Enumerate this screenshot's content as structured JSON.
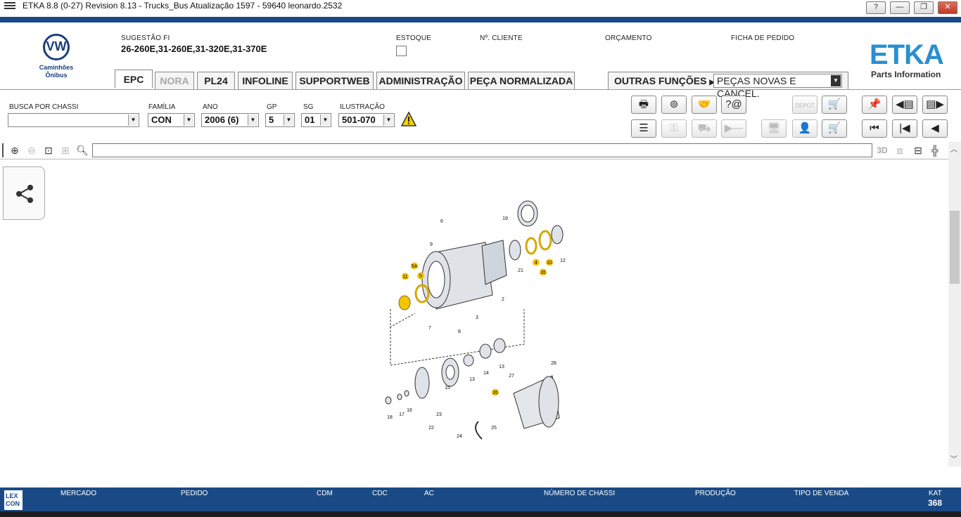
{
  "window": {
    "title": "ETKA 8.8 (0-27) Revision 8.13 - Trucks_Bus Atualização 1597 - 59640 leonardo.2532",
    "controls": [
      "?",
      "—",
      "❐",
      "✕"
    ]
  },
  "header": {
    "brand_lines": [
      "Caminhões",
      "Ônibus"
    ],
    "sugestao_label": "SUGESTÃO FI",
    "sugestao_value": "26-260E,31-260E,31-320E,31-370E",
    "estoque_label": "ESTOQUE",
    "cliente_label": "Nº. CLIENTE",
    "orcamento_label": "ORÇAMENTO",
    "ficha_label": "FICHA DE PEDIDO",
    "etka_logo": "ETKA",
    "etka_sub": "Parts Information"
  },
  "tabs": [
    {
      "label": "EPC",
      "state": "active"
    },
    {
      "label": "NORA",
      "state": "disabled"
    },
    {
      "label": "PL24",
      "state": "normal"
    },
    {
      "label": "INFOLINE",
      "state": "normal"
    },
    {
      "label": "SUPPORTWEB",
      "state": "normal"
    },
    {
      "label": "ADMINISTRAÇÃO",
      "state": "normal"
    },
    {
      "label": "PEÇA NORMALIZADA",
      "state": "normal"
    }
  ],
  "outras": {
    "label": "OUTRAS FUNÇÕES",
    "selected": "PEÇAS NOVAS E CANCEL."
  },
  "filters": {
    "chassi_label": "BUSCA POR CHASSI",
    "chassi_value": "",
    "familia_label": "FAMÍLIA",
    "familia_value": "CON",
    "ano_label": "ANO",
    "ano_value": "2006 (6)",
    "gp_label": "GP",
    "gp_value": "5",
    "sg_label": "SG",
    "sg_value": "01",
    "ilustracao_label": "ILUSTRAÇÃO",
    "ilustracao_value": "501-070"
  },
  "toolbar": {
    "row1": [
      {
        "icon": "printer-icon",
        "glyph": "🖶",
        "enabled": true
      },
      {
        "icon": "scanner-icon",
        "glyph": "⊚",
        "enabled": true
      },
      {
        "icon": "handshake-icon",
        "glyph": "🤝",
        "enabled": true
      },
      {
        "icon": "question-at-icon",
        "glyph": "?@",
        "enabled": true
      },
      {
        "icon": "depot-icon",
        "glyph": "DEPOT",
        "enabled": false
      },
      {
        "icon": "cart-out-icon",
        "glyph": "🛒",
        "enabled": true
      },
      {
        "icon": "pin-icon",
        "glyph": "📌",
        "enabled": true
      },
      {
        "icon": "doc-prev-icon",
        "glyph": "◀▤",
        "enabled": true
      },
      {
        "icon": "doc-next-icon",
        "glyph": "▤▶",
        "enabled": true
      }
    ],
    "row2": [
      {
        "icon": "list-icon",
        "glyph": "☰",
        "enabled": true
      },
      {
        "icon": "key-icon",
        "glyph": "⚿",
        "enabled": false
      },
      {
        "icon": "vehicle-icon",
        "glyph": "⛟",
        "enabled": false
      },
      {
        "icon": "play-minus-icon",
        "glyph": "▶—",
        "enabled": false
      },
      {
        "icon": "monitor-icon",
        "glyph": "🖥",
        "enabled": false
      },
      {
        "icon": "person-icon",
        "glyph": "👤",
        "enabled": false
      },
      {
        "icon": "cart-icon",
        "glyph": "🛒",
        "enabled": true
      },
      {
        "icon": "first-icon",
        "glyph": "⏮",
        "enabled": true
      },
      {
        "icon": "prev-icon",
        "glyph": "|◀",
        "enabled": true
      },
      {
        "icon": "back-icon",
        "glyph": "◀",
        "enabled": true
      }
    ]
  },
  "zoombar": {
    "threed_label": "3D"
  },
  "diagram": {
    "callouts": [
      "6",
      "19",
      "9",
      "5A",
      "11",
      "5",
      "21",
      "4",
      "10",
      "12",
      "26",
      "2",
      "3",
      "7",
      "8",
      "15",
      "13",
      "14",
      "13",
      "27",
      "28",
      "26",
      "18",
      "17",
      "16",
      "23",
      "22",
      "24",
      "25"
    ],
    "highlighted": [
      "5A",
      "11",
      "5",
      "4",
      "10",
      "26"
    ]
  },
  "bottom": {
    "lex": "LEX CON",
    "labels": [
      "MERCADO",
      "PEDIDO",
      "CDM",
      "CDC",
      "AC",
      "NÚMERO DE CHASSI",
      "PRODUÇÃO",
      "TIPO DE VENDA"
    ],
    "kat_label": "KAT",
    "kat_value": "368"
  },
  "colors": {
    "brand_blue": "#1a4a86",
    "etka_blue": "#2a8fcf",
    "highlight": "#f4c400"
  }
}
